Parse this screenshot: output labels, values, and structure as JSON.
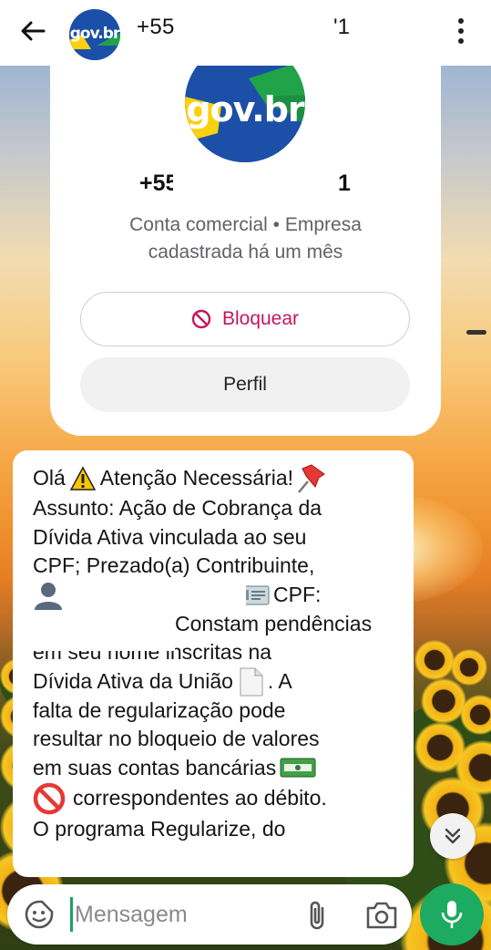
{
  "header": {
    "phone_prefix": "+55",
    "phone_suffix": "'1",
    "back_icon": "arrow-left-icon",
    "menu_icon": "more-vertical-icon"
  },
  "contact_card": {
    "logo_text": "gov.br",
    "phone_prefix": "+55",
    "phone_suffix": "1",
    "description_line1": "Conta comercial • Empresa",
    "description_line2": "cadastrada há um mês",
    "block_label": "Bloquear",
    "profile_label": "Perfil"
  },
  "message": {
    "line1_a": "Olá",
    "line1_b": "Atenção Necessária!",
    "line2": "Assunto: Ação de Cobrança da",
    "line3": "Dívida Ativa vinculada ao seu",
    "line4": "CPF; Prezado(a) Contribuinte,",
    "line5_cpf": "CPF:",
    "line6": "Constam pendências",
    "line7": "em seu nome inscritas na",
    "line8_a": "Dívida Ativa da União",
    "line8_b": ". A",
    "line9": "falta de regularização pode",
    "line10": "resultar no bloqueio de valores",
    "line11": "em suas contas bancárias",
    "line12": "correspondentes ao débito.",
    "line13": "O programa Regularize, do"
  },
  "composer": {
    "placeholder": "Mensagem"
  },
  "colors": {
    "accent_green": "#1daa61",
    "block_red": "#c2185b",
    "gov_blue": "#1c4fa8"
  }
}
